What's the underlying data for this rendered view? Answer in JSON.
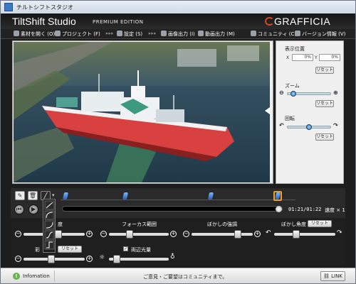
{
  "window": {
    "title": "チルトシフトスタジオ"
  },
  "header": {
    "brand": "TiltShift Studio",
    "edition": "PREMIUM EDITION",
    "logo": "GRAFFICIA"
  },
  "menu": {
    "items": [
      {
        "label": "素材を開く (O)",
        "icon": "folder-icon"
      },
      {
        "label": "プロジェクト (F)",
        "icon": "project-icon"
      },
      {
        "label": "設定 (S)",
        "icon": "gear-icon"
      },
      {
        "label": "画像出力 (I)",
        "icon": "image-icon"
      },
      {
        "label": "動画出力 (M)",
        "icon": "video-icon"
      }
    ],
    "separator": "»»»",
    "right": [
      {
        "label": "コミュニティ (C)",
        "icon": "chat-icon"
      },
      {
        "label": "バージョン情報 (V)",
        "icon": "info-icon"
      }
    ]
  },
  "right_panel": {
    "position": {
      "title": "表示位置",
      "x_label": "X",
      "x_value": "0%",
      "y_label": "Y",
      "y_value": "0%",
      "reset": "リセット"
    },
    "zoom": {
      "title": "ズーム",
      "reset": "リセット"
    },
    "rotation": {
      "title": "回転",
      "reset": "リセット"
    }
  },
  "timeline": {
    "timecode": "01:21/01:22",
    "speed": "速度 × 1",
    "keyframes": 4
  },
  "controls": {
    "focus_width_label": "フォーカス範囲",
    "blur_strength_label": "ぼかしの強調",
    "blur_angle_label": "ぼかし角度",
    "blur_angle_reset": "リセット",
    "saturation_label": "彩",
    "saturation_reset": "リセット",
    "brightness_label": "度",
    "both_ends_light_label": "両辺光量",
    "both_ends_light_checked": true
  },
  "status": {
    "info_label": "Infomation",
    "message": "ご意見・ご要望はコミュニティまで。",
    "link_label": "LINK"
  },
  "colors": {
    "accent": "#2f7fd0",
    "ship_red": "#d94040",
    "keyframe_selected": "#f0a020"
  }
}
